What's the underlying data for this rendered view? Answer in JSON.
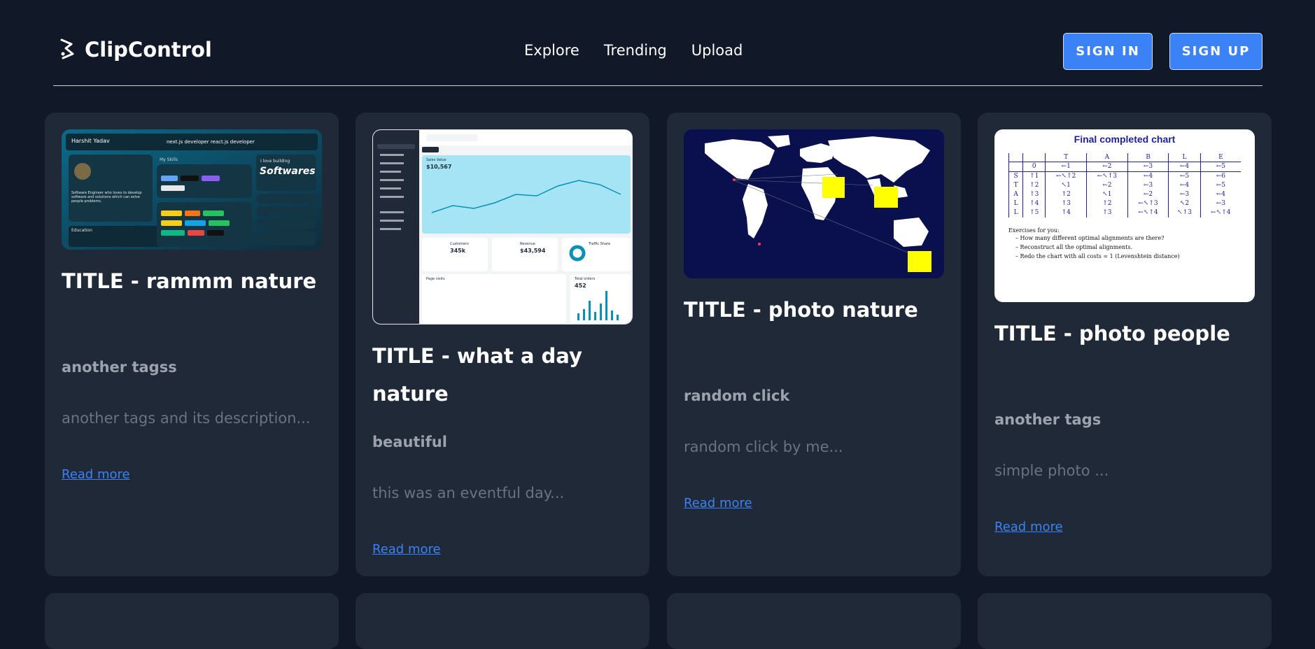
{
  "header": {
    "brand": "ClipControl",
    "nav": [
      "Explore",
      "Trending",
      "Upload"
    ],
    "sign_in": "SIGN IN",
    "sign_up": "SIGN UP"
  },
  "cards": [
    {
      "title": "TITLE - rammm nature",
      "tag": "another tagss",
      "description": "another tags and its description...",
      "link": "Read more",
      "thumb": {
        "name": "Harshit Yadav",
        "nav": "next.js developer   react.js developer",
        "skills": "My Skills",
        "headline": "Softwares",
        "sub": "I love building",
        "bio": "Software Engineer who loves to develop software and solutions which can solve people problems.",
        "education": "Education"
      }
    },
    {
      "title": "TITLE - what a day nature",
      "tag": "beautiful",
      "description": "this was an eventful day...",
      "link": "Read more",
      "thumb": {
        "sales_label": "Sales Value",
        "sales_value": "$10,567",
        "customers_label": "Customers",
        "customers_value": "345k",
        "revenue_label": "Revenue",
        "revenue_value": "$43,594",
        "traffic_label": "Traffic Share",
        "page_visits": "Page visits",
        "total_orders": "Total orders",
        "orders_value": "452"
      }
    },
    {
      "title": "TITLE - photo nature",
      "tag": "random click",
      "description": "random click by me...",
      "link": "Read more"
    },
    {
      "title": "TITLE - photo people",
      "tag": "another tags",
      "description": "simple photo ...",
      "link": "Read more",
      "thumb": {
        "chart_title": "Final completed chart",
        "columns": [
          "",
          "T",
          "A",
          "B",
          "L",
          "E"
        ],
        "rows": [
          [
            "",
            "0",
            "←1",
            "←2",
            "←3",
            "←4",
            "←5"
          ],
          [
            "S",
            "↑1",
            "←↖↑2",
            "←↖↑3",
            "←4",
            "←5",
            "←6"
          ],
          [
            "T",
            "↑2",
            "↖1",
            "←2",
            "←3",
            "←4",
            "←5"
          ],
          [
            "A",
            "↑3",
            "↑2",
            "↖1",
            "←2",
            "←3",
            "←4"
          ],
          [
            "L",
            "↑4",
            "↑3",
            "↑2",
            "←↖↑3",
            "↖2",
            "←3"
          ],
          [
            "L",
            "↑5",
            "↑4",
            "↑3",
            "←↖↑4",
            "↖↑3",
            "←↖↑4"
          ]
        ],
        "exercises_title": "Exercises for you:",
        "exercises": [
          "How many different optimal alignments are there?",
          "Reconstruct all the optimal alignments.",
          "Redo the chart with all costs = 1 (Levenshtein distance)"
        ]
      }
    }
  ]
}
